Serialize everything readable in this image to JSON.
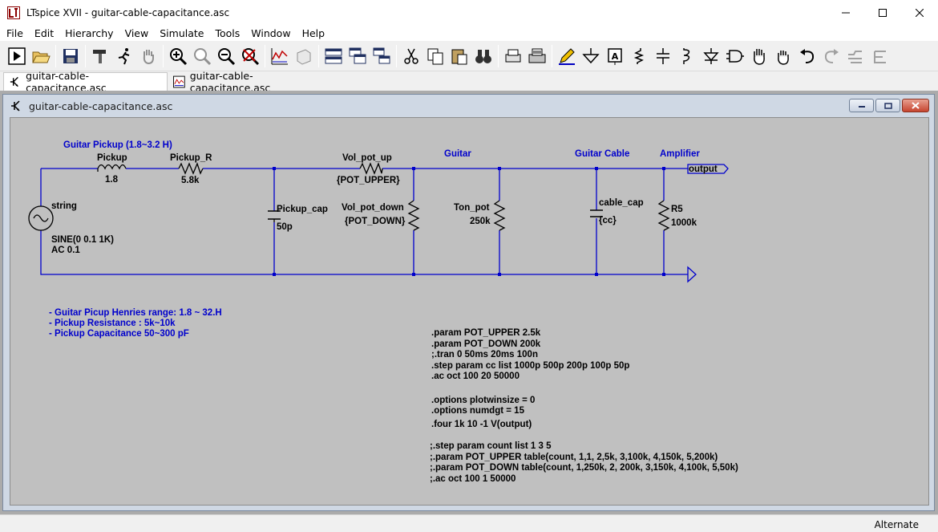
{
  "window": {
    "title": "LTspice XVII - guitar-cable-capacitance.asc"
  },
  "menu": [
    "File",
    "Edit",
    "Hierarchy",
    "View",
    "Simulate",
    "Tools",
    "Window",
    "Help"
  ],
  "tabs": [
    {
      "label": "guitar-cable-capacitance.asc",
      "icon": "schematic-icon",
      "active": true
    },
    {
      "label": "guitar-cable-capacitance.asc",
      "icon": "waveform-icon",
      "active": false
    }
  ],
  "child_window": {
    "title": "guitar-cable-capacitance.asc"
  },
  "schematic": {
    "colors": {
      "wire": "#0000cc",
      "background": "#c0c0c0",
      "comment": "#0000cc",
      "text": "#000000"
    },
    "comment_labels": {
      "pickup_title": "Guitar Pickup (1.8~3.2 H)",
      "guitar": "Guitar",
      "guitar_cable": "Guitar Cable",
      "amplifier": "Amplifier"
    },
    "components": {
      "source_name": "string",
      "source_value1": "SINE(0 0.1 1K)",
      "source_value2": "AC 0.1",
      "l1_name": "Pickup",
      "l1_value": "1.8",
      "r1_name": "Pickup_R",
      "r1_value": "5.8k",
      "c1_name": "Pickup_cap",
      "c1_value": "50p",
      "r2_name": "Vol_pot_up",
      "r2_value": "{POT_UPPER}",
      "r3_name": "Vol_pot_down",
      "r3_value": "{POT_DOWN}",
      "r4_name": "Ton_pot",
      "r4_value": "250k",
      "c2_name": "cable_cap",
      "c2_value": "{cc}",
      "r5_name": "R5",
      "r5_value": "1000k",
      "net_label": "output"
    },
    "notes": [
      "- Guitar Picup Henries range: 1.8 ~ 32.H",
      "- Pickup Resistance : 5k~10k",
      "- Pickup Capacitance 50~300 pF"
    ],
    "directives_a": [
      ".param POT_UPPER 2.5k",
      ".param POT_DOWN 200k",
      ";.tran 0 50ms 20ms 100n",
      ".step param cc list 1000p 500p 200p 100p 50p",
      ".ac oct 100 20 50000"
    ],
    "directives_b": [
      ".options plotwinsize = 0",
      ".options numdgt = 15",
      ".four 1k 10 -1 V(output)"
    ],
    "directives_c": [
      ";.step param count list 1 3 5",
      ";.param POT_UPPER table(count, 1,1, 2,5k, 3,100k, 4,150k, 5,200k)",
      ";.param POT_DOWN table(count, 1,250k, 2, 200k, 3,150k, 4,100k, 5,50k)",
      ";.ac oct 100 1 50000"
    ]
  },
  "status": {
    "text": "Alternate"
  }
}
